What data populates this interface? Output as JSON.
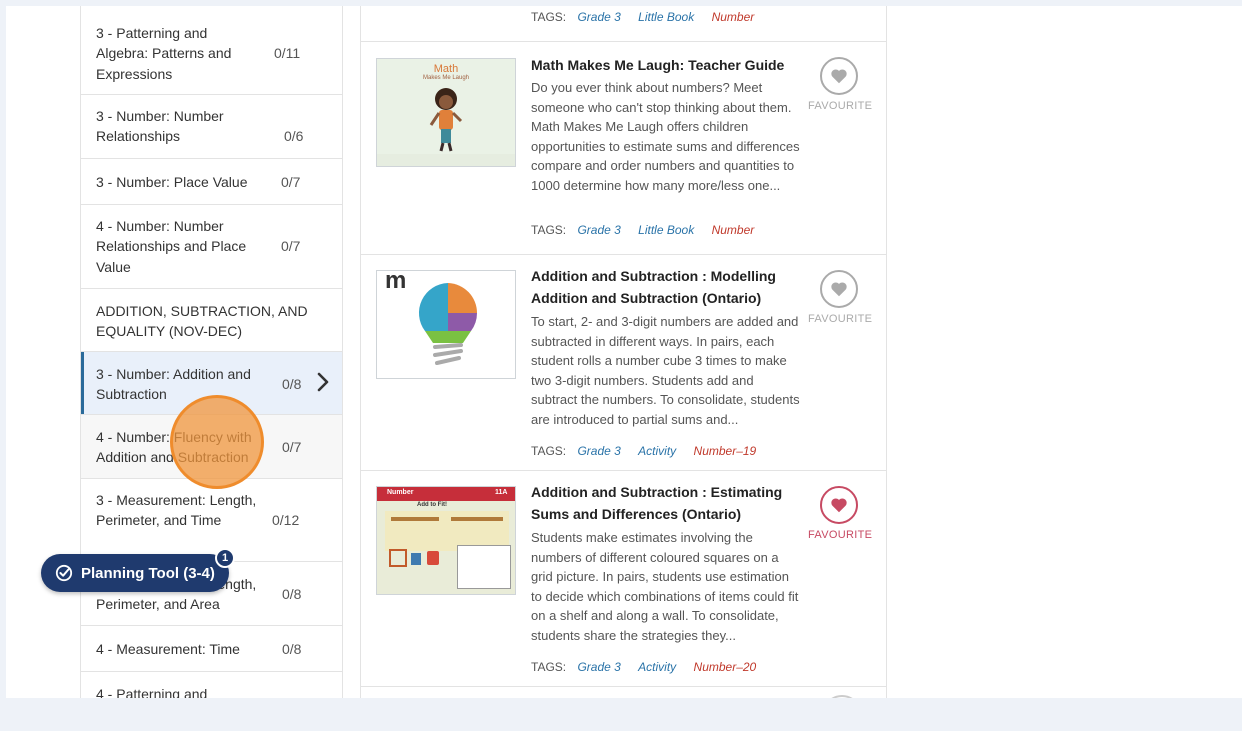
{
  "sidebar": {
    "items": [
      {
        "label": "3 - Patterning and Algebra: Patterns and Expressions",
        "count": "0/11"
      },
      {
        "label": "3 - Number: Number Relationships",
        "count": "0/6"
      },
      {
        "label": "3 - Number: Place Value",
        "count": "0/7"
      },
      {
        "label": "4 - Number: Number Relationships and Place Value",
        "count": "0/7"
      },
      {
        "label": "ADDITION, SUBTRACTION, AND EQUALITY (NOV-DEC)",
        "count": ""
      },
      {
        "label": "3 - Number: Addition and Subtraction",
        "count": "0/8"
      },
      {
        "label": "4 - Number: Fluency with Addition and Subtraction",
        "count": "0/7"
      },
      {
        "label": "3 - Measurement: Length, Perimeter, and Time",
        "count": "0/12"
      },
      {
        "label": "4 - Measurement: Length, Perimeter, and Area",
        "count": "0/8"
      },
      {
        "label": "4 - Measurement: Time",
        "count": "0/8"
      },
      {
        "label": "4 - Patterning and",
        "count": ""
      }
    ]
  },
  "cards": [
    {
      "title": "",
      "description": "",
      "tags_label": "TAGS:",
      "tags": [
        "Grade 3",
        "Little Book",
        "Number"
      ],
      "favourite_label": "",
      "favourited": false
    },
    {
      "title": "Math Makes Me Laugh: Teacher Guide",
      "description": "Do you ever think about numbers? Meet someone who can't stop thinking about them. Math Makes Me Laugh offers children opportunities to estimate sums and differences compare and order numbers and quantities to 1000 determine how many more/less one...",
      "tags_label": "TAGS:",
      "tags": [
        "Grade 3",
        "Little Book",
        "Number"
      ],
      "favourite_label": "FAVOURITE",
      "favourited": false,
      "thumb_title": "Math",
      "thumb_subtitle": "Makes Me Laugh"
    },
    {
      "title": "Addition and Subtraction : Modelling Addition and Subtraction (Ontario)",
      "description": "To start, 2- and 3-digit numbers are added and subtracted in different ways. In pairs, each student rolls a number cube 3 times to make two 3-digit numbers. Students add and subtract the numbers. To consolidate, students are introduced to partial sums and...",
      "tags_label": "TAGS:",
      "tags": [
        "Grade 3",
        "Activity",
        "Number–19"
      ],
      "favourite_label": "FAVOURITE",
      "favourited": false,
      "thumb_letter": "m"
    },
    {
      "title": "Addition and Subtraction : Estimating Sums and Differences (Ontario)",
      "description": "Students make estimates involving the numbers of different coloured squares on a grid picture. In pairs, students use estimation to decide which combinations of items could fit on a shelf and along a wall. To consolidate, students share the strategies they...",
      "tags_label": "TAGS:",
      "tags": [
        "Grade 3",
        "Activity",
        "Number–20"
      ],
      "favourite_label": "FAVOURITE",
      "favourited": true,
      "thumb_header": "Number",
      "thumb_subheader": "Add to Fit!",
      "thumb_code": "11A"
    }
  ],
  "planning_tool": {
    "label": "Planning Tool (3-4)",
    "badge": "1"
  },
  "colors": {
    "accent": "#1f3a6e",
    "tag_blue": "#2a73a8",
    "tag_red": "#c0392b",
    "fav_on": "#c74a63",
    "active_bg": "#e9f0fa"
  }
}
